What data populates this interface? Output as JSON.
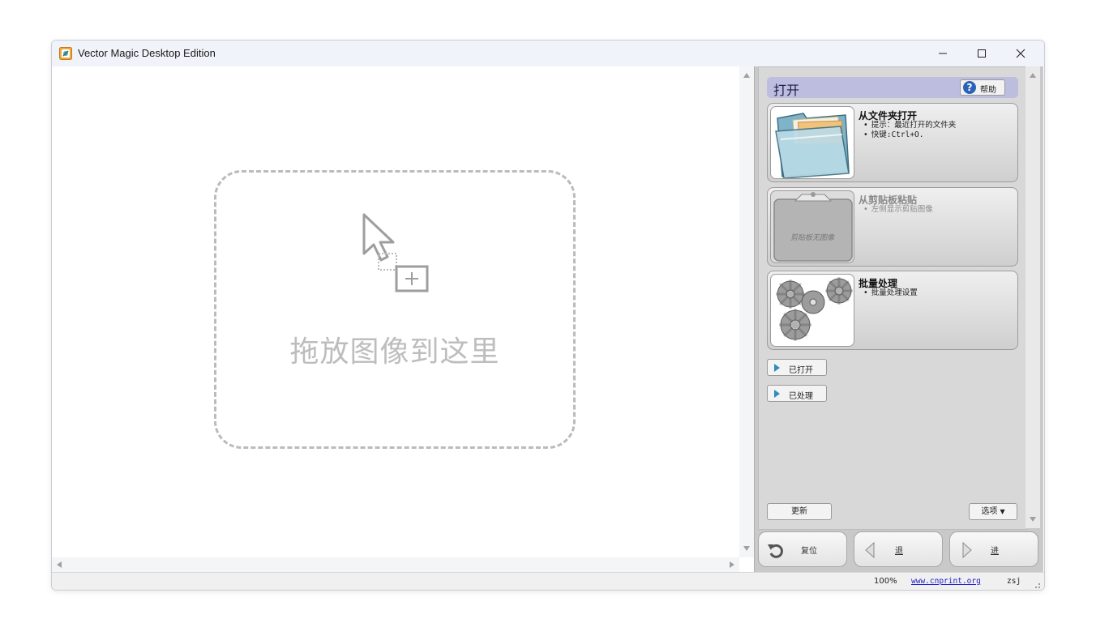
{
  "window": {
    "title": "Vector Magic Desktop Edition"
  },
  "canvas": {
    "drop_text": "拖放图像到这里"
  },
  "panel": {
    "title": "打开",
    "help_label": "帮助",
    "cards": [
      {
        "title": "从文件夹打开",
        "bullets": [
          "提示：最近打开的文件夹",
          "快键:Ctrl+O."
        ],
        "icon": "folder-icon"
      },
      {
        "title": "从剪贴板粘贴",
        "bullets": [
          "左侧显示剪贴图像"
        ],
        "thumb_text": "剪贴板无图像",
        "icon": "clipboard-icon"
      },
      {
        "title": "批量处理",
        "bullets": [
          "批量处理设置"
        ],
        "icon": "gears-icon"
      }
    ],
    "sections": [
      "已打开",
      "已处理"
    ],
    "update_label": "更新",
    "options_label": "选项"
  },
  "nav": {
    "reset_label": "复位",
    "back_label": "退",
    "next_label": "进"
  },
  "status": {
    "zoom": "100%",
    "link": "www.cnprint.org",
    "user": "zsj"
  },
  "colors": {
    "panel_header": "#bdbde0",
    "section_triangle": "#2f8fb8",
    "link": "#2222cc"
  }
}
